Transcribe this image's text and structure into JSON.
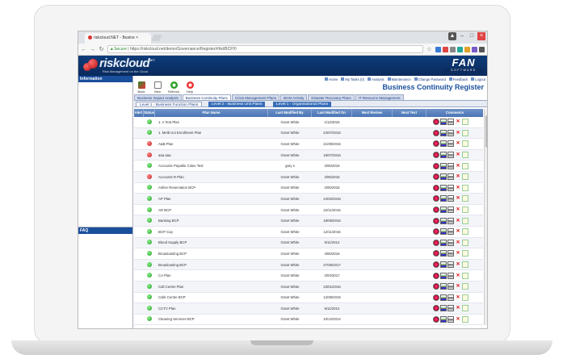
{
  "browser": {
    "tab_title": "riskcloud.NET - Busine",
    "url_prefix": "Secure",
    "url": "https://riskcloud.net/demo/Governance/Register/#list/BCP/0"
  },
  "app": {
    "logo_text": "riskcloud",
    "logo_net": ".NET",
    "logo_tagline": "Risk Management on the Cloud",
    "brand_logo": "FAN",
    "brand_sub": "SOFTWARE"
  },
  "sidebar": {
    "information_label": "Information",
    "faq_label": "FAQ"
  },
  "top_links": [
    "Home",
    "My Tasks (0)",
    "Analysis",
    "Maintenance",
    "Change Password",
    "Feedback",
    "Logout"
  ],
  "page_title": "Business Continuity Register",
  "toolbar": [
    "Back",
    "New",
    "Refresh",
    "Help"
  ],
  "tabs_primary": [
    "Business Impact Analysis",
    "Business Continuity Plans",
    "Crisis Management Plans",
    "BCM Activity",
    "Disaster Recovery Plans",
    "IT Resource Management"
  ],
  "tabs_secondary": [
    "Level 1 - Business Function Plans",
    "Level 2 - Business Unit Plans",
    "Level 1 - Organisational Plans"
  ],
  "columns": [
    "Alert",
    "Status",
    "Plan Name",
    "Last Modified By",
    "Last Modified On",
    "Next Review",
    "Next Test",
    "Comments"
  ],
  "rows": [
    {
      "status": "green",
      "name": "1. A Test Plan",
      "by": "Grant White",
      "on": "1/12/2016"
    },
    {
      "status": "green",
      "name": "1. Melb Uni Enrollment Plan",
      "by": "Grant White",
      "on": "24/07/2016"
    },
    {
      "status": "red",
      "name": "A&B Plan",
      "by": "Grant White",
      "on": "21/09/2016"
    },
    {
      "status": "red",
      "name": "aaa aaa",
      "by": "Grant White",
      "on": "19/07/2016"
    },
    {
      "status": "green",
      "name": "Accounts Payable Coles Test",
      "by": "gary s",
      "on": "2/05/2016"
    },
    {
      "status": "red",
      "name": "Accounts R Plan",
      "by": "Grant White",
      "on": "2/05/2016"
    },
    {
      "status": "green",
      "name": "Airline Reservation BCP",
      "by": "Grant White",
      "on": "2/05/2016"
    },
    {
      "status": "green",
      "name": "AP Plan",
      "by": "Grant White",
      "on": "24/02/2016"
    },
    {
      "status": "green",
      "name": "AR BCP",
      "by": "Grant White",
      "on": "22/11/2015"
    },
    {
      "status": "green",
      "name": "Banking BCP",
      "by": "Grant White",
      "on": "19/05/2016"
    },
    {
      "status": "green",
      "name": "BCP Cop",
      "by": "Grant White",
      "on": "12/11/2015"
    },
    {
      "status": "green",
      "name": "Blood Supply BCP",
      "by": "Grant White",
      "on": "5/11/2014"
    },
    {
      "status": "green",
      "name": "Broadcasting BCP",
      "by": "Grant White",
      "on": "4/05/2016"
    },
    {
      "status": "green",
      "name": "Broadcasting BCP",
      "by": "Grant White",
      "on": "27/06/2017"
    },
    {
      "status": "green",
      "name": "CA Plan",
      "by": "Grant White",
      "on": "2/03/2017"
    },
    {
      "status": "green",
      "name": "Call Centre Plan",
      "by": "Grant White",
      "on": "23/01/2016"
    },
    {
      "status": "green",
      "name": "Calls Centre BCP",
      "by": "Grant White",
      "on": "12/08/2015"
    },
    {
      "status": "green",
      "name": "CCTV Plan",
      "by": "Grant White",
      "on": "6/11/2014"
    },
    {
      "status": "green",
      "name": "Cleaning Services BCP",
      "by": "Grant White",
      "on": "10/12/2014"
    }
  ]
}
